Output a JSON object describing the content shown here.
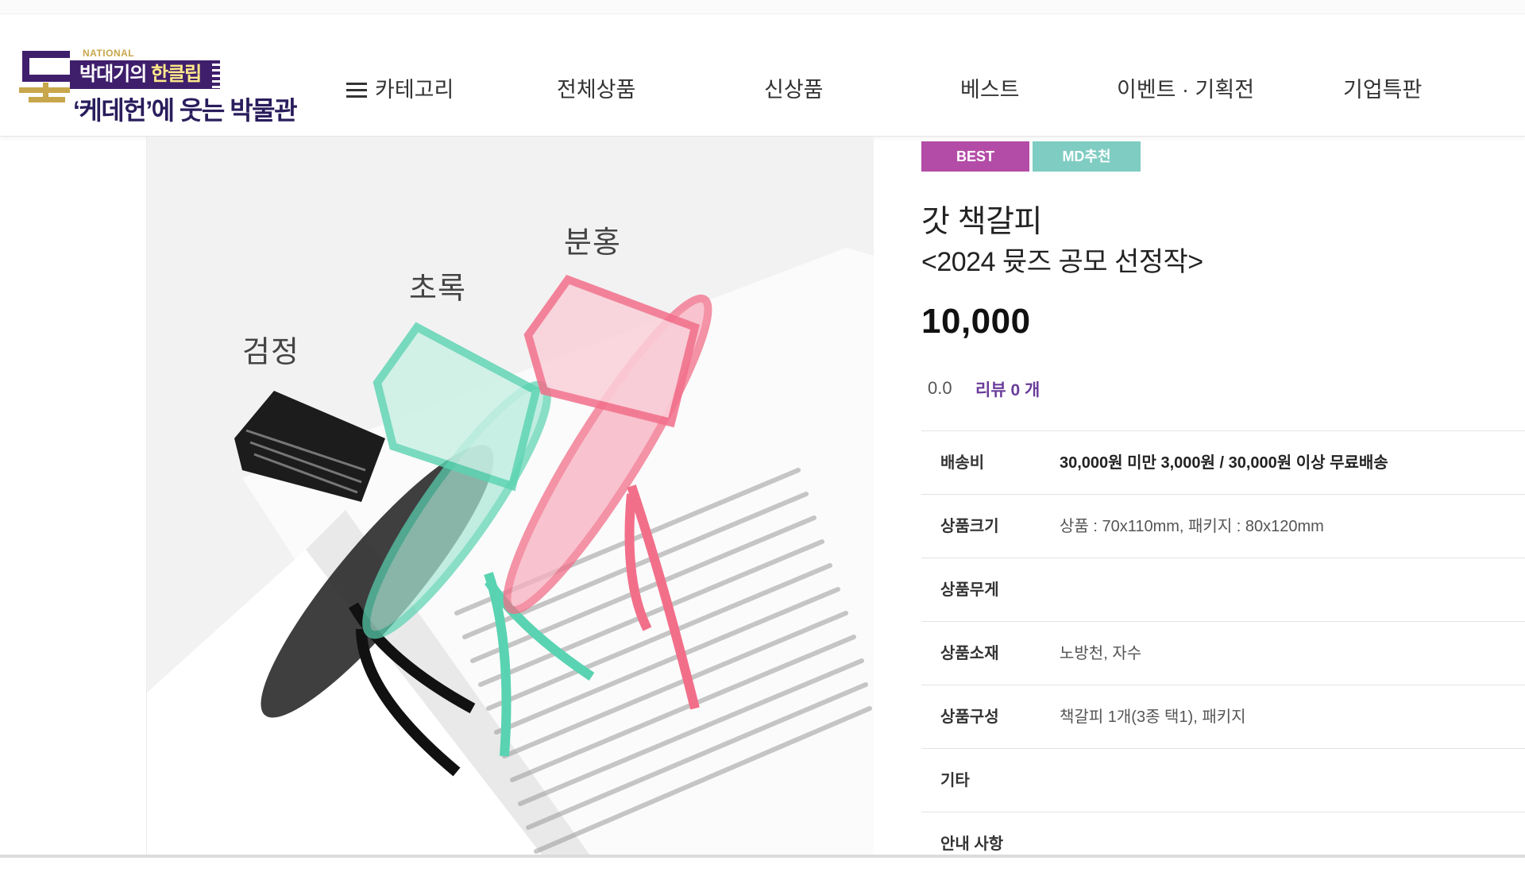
{
  "broadcast": {
    "national": "NATIONAL",
    "tag_prefix": "박대기의",
    "tag_emph": "한클립",
    "title": "‘케데헌’에 웃는 박물관"
  },
  "nav": {
    "category": "카테고리",
    "all_products": "전체상품",
    "new": "신상품",
    "best": "베스트",
    "events": "이벤트 · 기획전",
    "corporate": "기업특판"
  },
  "product_image": {
    "labels": {
      "black": "검정",
      "green": "초록",
      "pink": "분홍"
    }
  },
  "product": {
    "badges": {
      "best": "BEST",
      "md": "MD추천"
    },
    "name": "갓 책갈피",
    "subtitle": "<2024 뮷즈 공모 선정작>",
    "price": "10,000",
    "rating": "0.0",
    "reviews": "리뷰 0 개"
  },
  "specs": [
    {
      "label": "배송비",
      "value": "30,000원 미만 3,000원 / 30,000원 이상 무료배송"
    },
    {
      "label": "상품크기",
      "value": "상품 : 70x110mm, 패키지 : 80x120mm"
    },
    {
      "label": "상품무게",
      "value": ""
    },
    {
      "label": "상품소재",
      "value": "노방천, 자수"
    },
    {
      "label": "상품구성",
      "value": "책갈피 1개(3종 택1), 패키지"
    },
    {
      "label": "기타",
      "value": ""
    },
    {
      "label": "안내 사항",
      "value": ""
    }
  ],
  "colors": {
    "brand_purple": "#3f1f6c",
    "badge_best": "#b34ca7",
    "badge_md": "#7fccc2",
    "review_link": "#6a3d9a",
    "hat_black": "#1c1c1c",
    "hat_green": "#59d3b1",
    "hat_pink": "#f26f8a"
  }
}
